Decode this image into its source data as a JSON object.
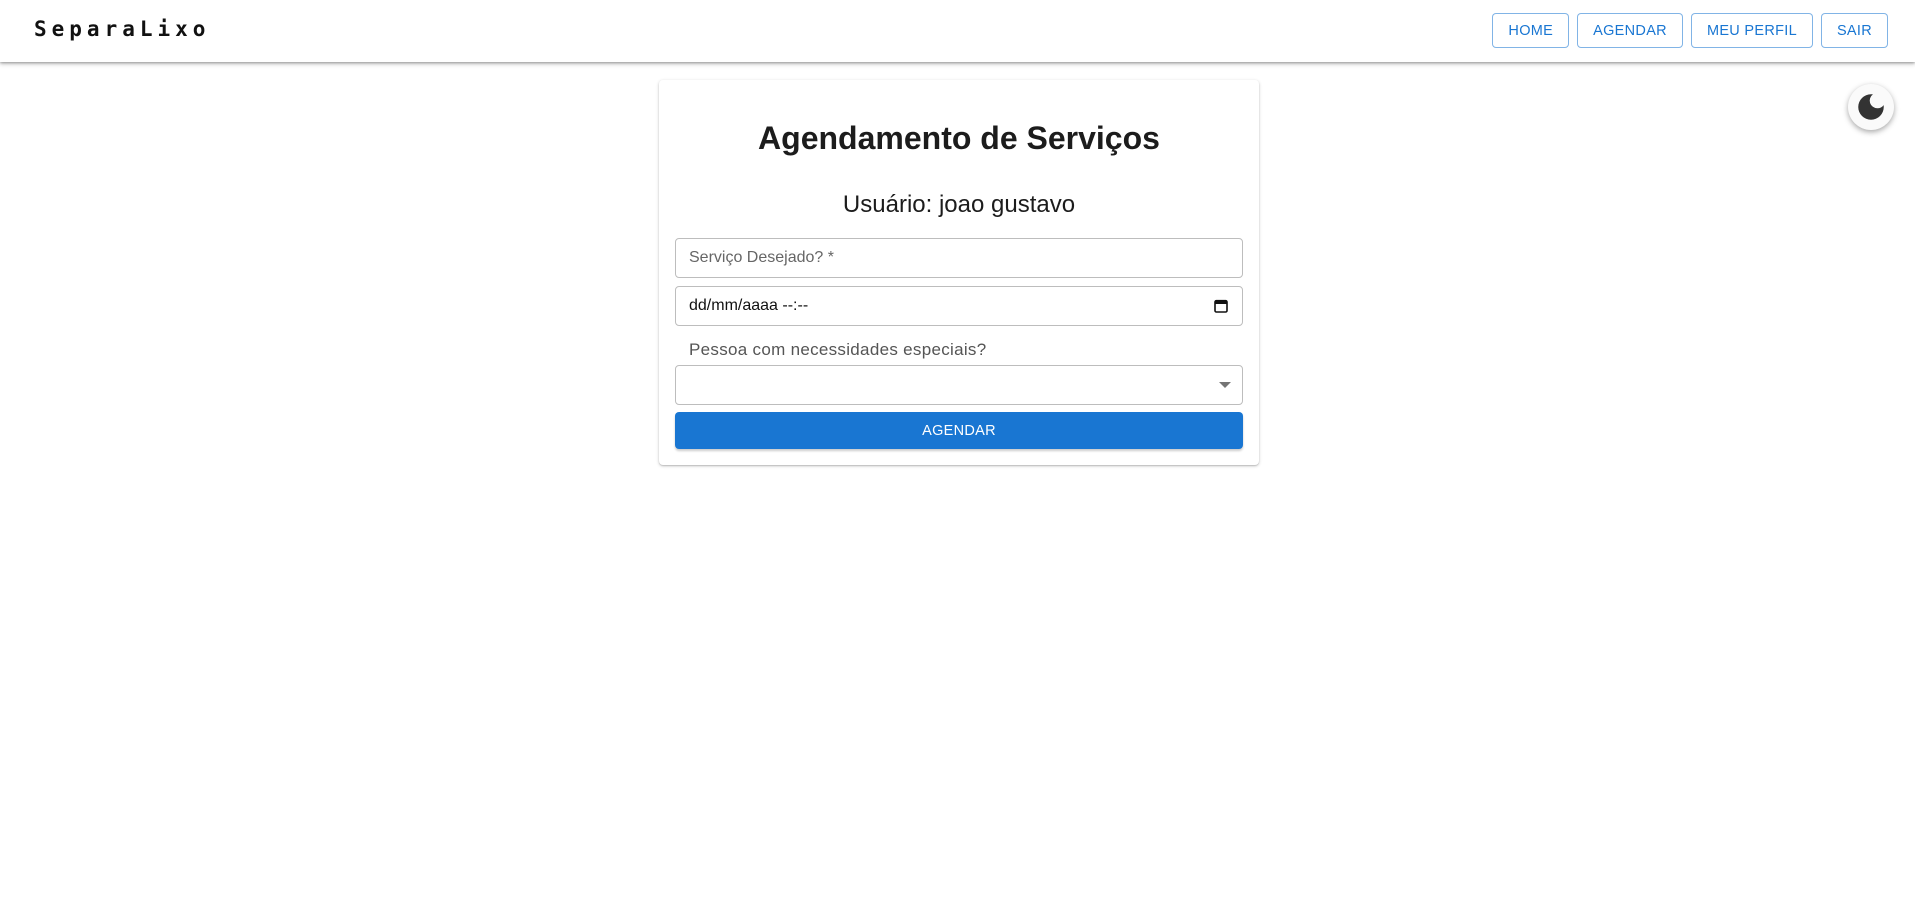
{
  "header": {
    "brand": "SeparaLixo",
    "nav": [
      {
        "label": "HOME"
      },
      {
        "label": "AGENDAR"
      },
      {
        "label": "MEU PERFIL"
      },
      {
        "label": "SAIR"
      }
    ]
  },
  "theme_toggle": {
    "icon": "moon-icon"
  },
  "form": {
    "title": "Agendamento de Serviços",
    "user_text": "Usuário: joao gustavo",
    "service_placeholder": "Serviço Desejado? *",
    "date_value": "dd/mm/aaaa --:--",
    "date_icon": "calendar-icon",
    "special_needs_label": "Pessoa com necessidades especiais?",
    "special_needs_value": "",
    "select_icon": "caret-down-icon",
    "submit_label": "AGENDAR"
  },
  "colors": {
    "primary": "#1976d2",
    "text": "#1c1c1c"
  }
}
